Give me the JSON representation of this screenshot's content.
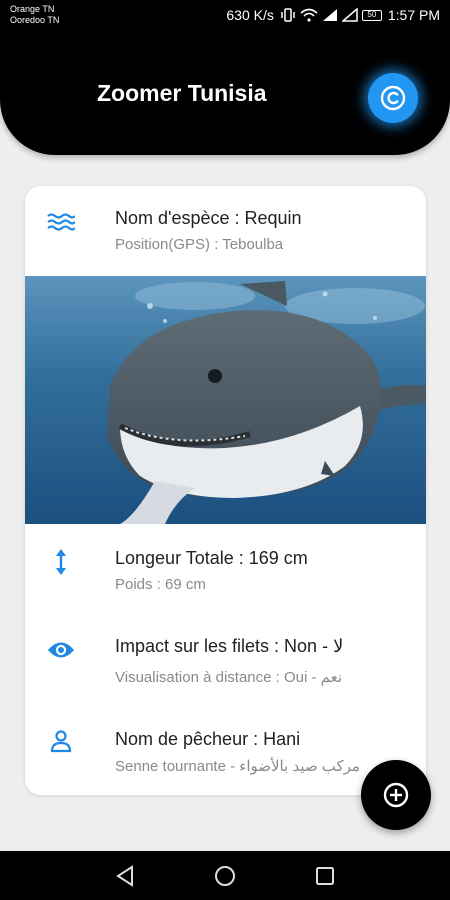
{
  "status_bar": {
    "carrier_1": "Orange TN",
    "carrier_2": "Ooredoo TN",
    "speed": "630 K/s",
    "battery": "50",
    "time": "1:57 PM"
  },
  "header": {
    "title": "Zoomer Tunisia",
    "action_icon": "copyright-icon",
    "accent": "#2196f3"
  },
  "card": {
    "species": "Nom d'espèce : Requin",
    "position": "Position(GPS) : Teboulba",
    "length": "Longeur Totale : 169 cm",
    "weight": "Poids : 69 cm",
    "impact": "Impact sur les filets : Non - لا",
    "visualisation": "Visualisation à distance : Oui - نعم",
    "fisher": "Nom de pêcheur : Hani",
    "method": "Senne tournante - مركب صيد بالأضواء",
    "icon_color": "#1e88e5"
  },
  "fab": {
    "icon": "add-circle-icon"
  },
  "nav_bar": {
    "icons": [
      "back-icon",
      "home-icon",
      "recents-icon"
    ]
  }
}
